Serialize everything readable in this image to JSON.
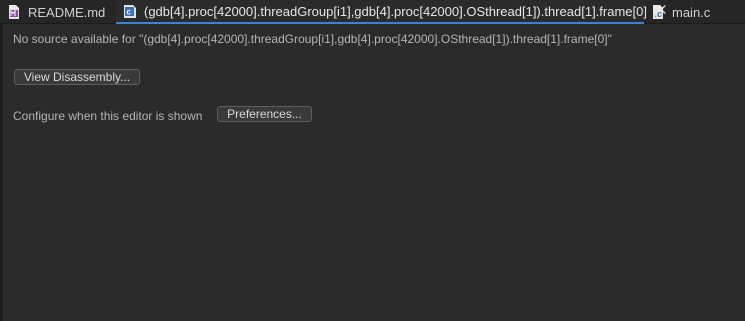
{
  "tabs": [
    {
      "label": "README.md",
      "icon": "markdown-file-icon",
      "active": false
    },
    {
      "label": "(gdb[4].proc[42000].threadGroup[i1],gdb[4].proc[42000].OSthread[1]).thread[1].frame[0]",
      "icon": "c-file-icon",
      "active": true
    },
    {
      "label": "main.c",
      "icon": "c-file-icon",
      "active": false
    }
  ],
  "editor": {
    "message": "No source available for \"(gdb[4].proc[42000].threadGroup[i1],gdb[4].proc[42000].OSthread[1]).thread[1].frame[0]\"",
    "view_disassembly_label": "View Disassembly...",
    "configure_label": "Configure when this editor is shown",
    "preferences_label": "Preferences..."
  },
  "colors": {
    "background": "#2b2b2b",
    "tabbar": "#262626",
    "active_tab_underline": "#3c82d6",
    "text": "#b4b4b4"
  }
}
